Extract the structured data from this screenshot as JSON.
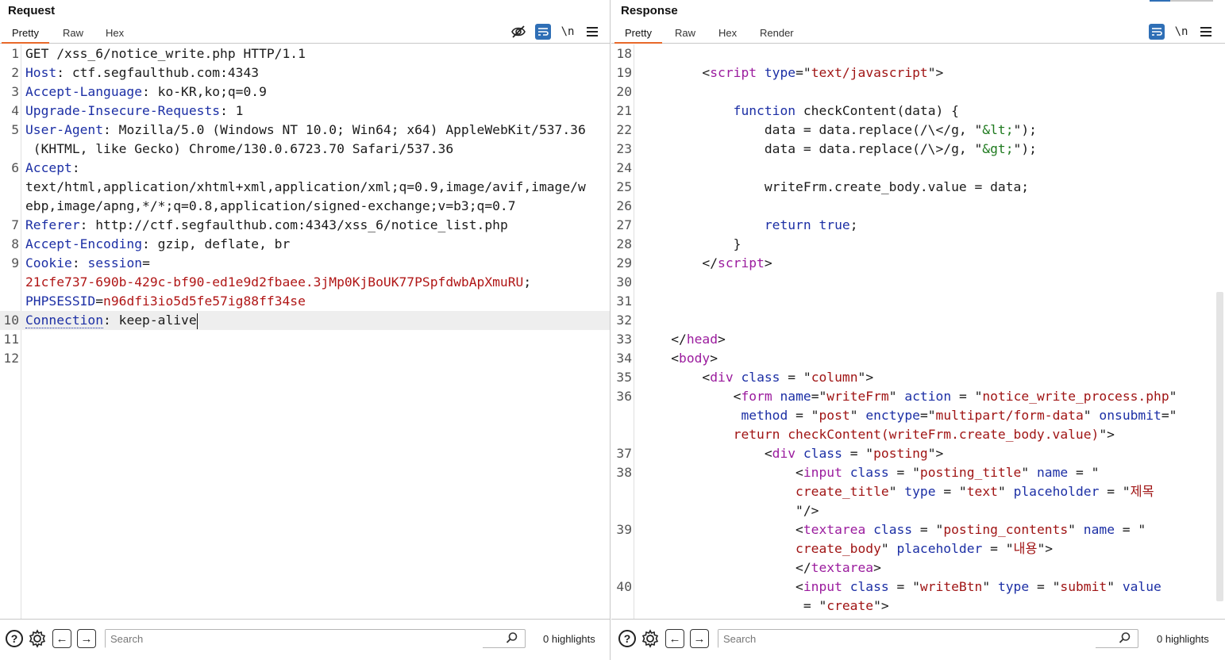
{
  "request": {
    "title": "Request",
    "tabs": [
      "Pretty",
      "Raw",
      "Hex"
    ],
    "active_tab": "Pretty",
    "toolbar": {
      "newline_label": "\\n"
    },
    "lines": [
      {
        "n": "1",
        "parts": [
          [
            "hv",
            "GET /xss_6/notice_write.php HTTP/1.1"
          ]
        ]
      },
      {
        "n": "2",
        "parts": [
          [
            "hk",
            "Host"
          ],
          [
            "hv",
            ": ctf.segfaulthub.com:4343"
          ]
        ]
      },
      {
        "n": "3",
        "parts": [
          [
            "hk",
            "Accept-Language"
          ],
          [
            "hv",
            ": ko-KR,ko;q=0.9"
          ]
        ]
      },
      {
        "n": "4",
        "parts": [
          [
            "hk",
            "Upgrade-Insecure-Requests"
          ],
          [
            "hv",
            ": 1"
          ]
        ]
      },
      {
        "n": "5",
        "parts": [
          [
            "hk",
            "User-Agent"
          ],
          [
            "hv",
            ": Mozilla/5.0 (Windows NT 10.0; Win64; x64) AppleWebKit/537.36"
          ]
        ]
      },
      {
        "n": "",
        "parts": [
          [
            "hv",
            " (KHTML, like Gecko) Chrome/130.0.6723.70 Safari/537.36"
          ]
        ]
      },
      {
        "n": "6",
        "parts": [
          [
            "hk",
            "Accept"
          ],
          [
            "hv",
            ":"
          ]
        ]
      },
      {
        "n": "",
        "parts": [
          [
            "hv",
            "text/html,application/xhtml+xml,application/xml;q=0.9,image/avif,image/w"
          ]
        ]
      },
      {
        "n": "",
        "parts": [
          [
            "hv",
            "ebp,image/apng,*/*;q=0.8,application/signed-exchange;v=b3;q=0.7"
          ]
        ]
      },
      {
        "n": "7",
        "parts": [
          [
            "hk",
            "Referer"
          ],
          [
            "hv",
            ": http://ctf.segfaulthub.com:4343/xss_6/notice_list.php"
          ]
        ]
      },
      {
        "n": "8",
        "parts": [
          [
            "hk",
            "Accept-Encoding"
          ],
          [
            "hv",
            ": gzip, deflate, br"
          ]
        ]
      },
      {
        "n": "9",
        "parts": [
          [
            "hk",
            "Cookie"
          ],
          [
            "hv",
            ": "
          ],
          [
            "hk",
            "session"
          ],
          [
            "hv",
            "="
          ]
        ]
      },
      {
        "n": "",
        "parts": [
          [
            "ck",
            "21cfe737-690b-429c-bf90-ed1e9d2fbaee.3jMp0KjBoUK77PSpfdwbApXmuRU"
          ],
          [
            "hv",
            ";"
          ]
        ]
      },
      {
        "n": "",
        "parts": [
          [
            "hk",
            "PHPSESSID"
          ],
          [
            "hv",
            "="
          ],
          [
            "ck",
            "n96dfi3io5d5fe57ig88ff34se"
          ]
        ]
      },
      {
        "n": "10",
        "parts": [
          [
            "hk",
            "Connection"
          ],
          [
            "hv",
            ": keep-alive"
          ]
        ],
        "current": true
      },
      {
        "n": "11",
        "parts": []
      },
      {
        "n": "12",
        "parts": []
      }
    ],
    "search_placeholder": "Search",
    "highlights": "0 highlights"
  },
  "response": {
    "title": "Response",
    "tabs": [
      "Pretty",
      "Raw",
      "Hex",
      "Render"
    ],
    "active_tab": "Pretty",
    "toolbar": {
      "newline_label": "\\n"
    },
    "lines": [
      {
        "n": "18",
        "parts": []
      },
      {
        "n": "19",
        "parts": [
          [
            "hv",
            "        <"
          ],
          [
            "tg",
            "script"
          ],
          [
            "hv",
            " "
          ],
          [
            "at",
            "type"
          ],
          [
            "hv",
            "=\""
          ],
          [
            "av",
            "text/javascript"
          ],
          [
            "hv",
            "\">"
          ]
        ]
      },
      {
        "n": "20",
        "parts": []
      },
      {
        "n": "21",
        "parts": [
          [
            "hv",
            "            "
          ],
          [
            "kw",
            "function"
          ],
          [
            "hv",
            " checkContent(data) {"
          ]
        ]
      },
      {
        "n": "22",
        "parts": [
          [
            "hv",
            "                data = data.replace(/\\</g, \""
          ],
          [
            "st",
            "&lt;"
          ],
          [
            "hv",
            "\");"
          ]
        ]
      },
      {
        "n": "23",
        "parts": [
          [
            "hv",
            "                data = data.replace(/\\>/g, \""
          ],
          [
            "st",
            "&gt;"
          ],
          [
            "hv",
            "\");"
          ]
        ]
      },
      {
        "n": "24",
        "parts": []
      },
      {
        "n": "25",
        "parts": [
          [
            "hv",
            "                writeFrm.create_body.value = data;"
          ]
        ]
      },
      {
        "n": "26",
        "parts": []
      },
      {
        "n": "27",
        "parts": [
          [
            "hv",
            "                "
          ],
          [
            "kw",
            "return"
          ],
          [
            "hv",
            " "
          ],
          [
            "kw",
            "true"
          ],
          [
            "hv",
            ";"
          ]
        ]
      },
      {
        "n": "28",
        "parts": [
          [
            "hv",
            "            }"
          ]
        ]
      },
      {
        "n": "29",
        "parts": [
          [
            "hv",
            "        </"
          ],
          [
            "tg",
            "script"
          ],
          [
            "hv",
            ">"
          ]
        ]
      },
      {
        "n": "30",
        "parts": []
      },
      {
        "n": "31",
        "parts": []
      },
      {
        "n": "32",
        "parts": []
      },
      {
        "n": "33",
        "parts": [
          [
            "hv",
            "    </"
          ],
          [
            "tg",
            "head"
          ],
          [
            "hv",
            ">"
          ]
        ]
      },
      {
        "n": "34",
        "parts": [
          [
            "hv",
            "    <"
          ],
          [
            "tg",
            "body"
          ],
          [
            "hv",
            ">"
          ]
        ]
      },
      {
        "n": "35",
        "parts": [
          [
            "hv",
            "        <"
          ],
          [
            "tg",
            "div"
          ],
          [
            "hv",
            " "
          ],
          [
            "at",
            "class"
          ],
          [
            "hv",
            " = \""
          ],
          [
            "av",
            "column"
          ],
          [
            "hv",
            "\">"
          ]
        ]
      },
      {
        "n": "36",
        "parts": [
          [
            "hv",
            "            <"
          ],
          [
            "tg",
            "form"
          ],
          [
            "hv",
            " "
          ],
          [
            "at",
            "name"
          ],
          [
            "hv",
            "=\""
          ],
          [
            "av",
            "writeFrm"
          ],
          [
            "hv",
            "\" "
          ],
          [
            "at",
            "action"
          ],
          [
            "hv",
            " = \""
          ],
          [
            "av",
            "notice_write_process.php"
          ],
          [
            "hv",
            "\""
          ]
        ]
      },
      {
        "n": "",
        "parts": [
          [
            "hv",
            "             "
          ],
          [
            "at",
            "method"
          ],
          [
            "hv",
            " = \""
          ],
          [
            "av",
            "post"
          ],
          [
            "hv",
            "\" "
          ],
          [
            "at",
            "enctype"
          ],
          [
            "hv",
            "=\""
          ],
          [
            "av",
            "multipart/form-data"
          ],
          [
            "hv",
            "\" "
          ],
          [
            "at",
            "onsubmit"
          ],
          [
            "hv",
            "=\""
          ]
        ]
      },
      {
        "n": "",
        "parts": [
          [
            "hv",
            "            "
          ],
          [
            "av",
            "return checkContent(writeFrm.create_body.value)"
          ],
          [
            "hv",
            "\">"
          ]
        ]
      },
      {
        "n": "37",
        "parts": [
          [
            "hv",
            "                <"
          ],
          [
            "tg",
            "div"
          ],
          [
            "hv",
            " "
          ],
          [
            "at",
            "class"
          ],
          [
            "hv",
            " = \""
          ],
          [
            "av",
            "posting"
          ],
          [
            "hv",
            "\">"
          ]
        ]
      },
      {
        "n": "38",
        "parts": [
          [
            "hv",
            "                    <"
          ],
          [
            "tg",
            "input"
          ],
          [
            "hv",
            " "
          ],
          [
            "at",
            "class"
          ],
          [
            "hv",
            " = \""
          ],
          [
            "av",
            "posting_title"
          ],
          [
            "hv",
            "\" "
          ],
          [
            "at",
            "name"
          ],
          [
            "hv",
            " = \""
          ]
        ]
      },
      {
        "n": "",
        "parts": [
          [
            "hv",
            "                    "
          ],
          [
            "av",
            "create_title"
          ],
          [
            "hv",
            "\" "
          ],
          [
            "at",
            "type"
          ],
          [
            "hv",
            " = \""
          ],
          [
            "av",
            "text"
          ],
          [
            "hv",
            "\" "
          ],
          [
            "at",
            "placeholder"
          ],
          [
            "hv",
            " = \""
          ],
          [
            "av",
            "제목"
          ]
        ]
      },
      {
        "n": "",
        "parts": [
          [
            "hv",
            "                    \"/>"
          ]
        ]
      },
      {
        "n": "39",
        "parts": [
          [
            "hv",
            "                    <"
          ],
          [
            "tg",
            "textarea"
          ],
          [
            "hv",
            " "
          ],
          [
            "at",
            "class"
          ],
          [
            "hv",
            " = \""
          ],
          [
            "av",
            "posting_contents"
          ],
          [
            "hv",
            "\" "
          ],
          [
            "at",
            "name"
          ],
          [
            "hv",
            " = \""
          ]
        ]
      },
      {
        "n": "",
        "parts": [
          [
            "hv",
            "                    "
          ],
          [
            "av",
            "create_body"
          ],
          [
            "hv",
            "\" "
          ],
          [
            "at",
            "placeholder"
          ],
          [
            "hv",
            " = \""
          ],
          [
            "av",
            "내용"
          ],
          [
            "hv",
            "\">"
          ]
        ]
      },
      {
        "n": "",
        "parts": [
          [
            "hv",
            "                    </"
          ],
          [
            "tg",
            "textarea"
          ],
          [
            "hv",
            ">"
          ]
        ]
      },
      {
        "n": "40",
        "parts": [
          [
            "hv",
            "                    <"
          ],
          [
            "tg",
            "input"
          ],
          [
            "hv",
            " "
          ],
          [
            "at",
            "class"
          ],
          [
            "hv",
            " = \""
          ],
          [
            "av",
            "writeBtn"
          ],
          [
            "hv",
            "\" "
          ],
          [
            "at",
            "type"
          ],
          [
            "hv",
            " = \""
          ],
          [
            "av",
            "submit"
          ],
          [
            "hv",
            "\" "
          ],
          [
            "at",
            "value"
          ]
        ]
      },
      {
        "n": "",
        "parts": [
          [
            "hv",
            "                     = \""
          ],
          [
            "av",
            "create"
          ],
          [
            "hv",
            "\">"
          ]
        ]
      }
    ],
    "search_placeholder": "Search",
    "highlights": "0 highlights"
  },
  "icons": {
    "hide": "eye-off-icon",
    "wrap": "word-wrap-icon",
    "menu": "hamburger-menu-icon",
    "help": "help-icon",
    "settings": "gear-icon",
    "back": "arrow-left-icon",
    "forward": "arrow-right-icon",
    "search": "search-icon"
  },
  "colors": {
    "accent_tab": "#e8692a",
    "header_key": "#1c2fa5",
    "cookie_value": "#b01616",
    "tag": "#9b1c9e",
    "attr_value": "#a01515",
    "string": "#1f7a1f"
  }
}
